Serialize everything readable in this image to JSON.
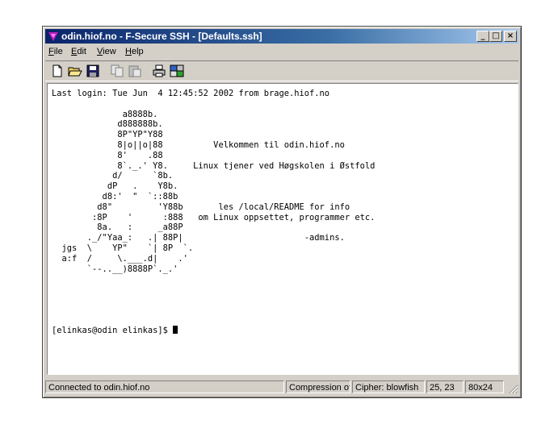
{
  "window": {
    "title": "odin.hiof.no - F-Secure SSH - [Defaults.ssh]",
    "buttons": {
      "minimize": "_",
      "maximize": "□",
      "close": "×"
    }
  },
  "menubar": {
    "items": [
      {
        "label": "File",
        "accel": "F",
        "rest": "ile"
      },
      {
        "label": "Edit",
        "accel": "E",
        "rest": "dit"
      },
      {
        "label": "View",
        "accel": "V",
        "rest": "iew"
      },
      {
        "label": "Help",
        "accel": "H",
        "rest": "elp"
      }
    ]
  },
  "toolbar": {
    "buttons": [
      {
        "name": "new-icon"
      },
      {
        "name": "open-folder-icon"
      },
      {
        "name": "save-icon"
      },
      {
        "name": "copy-icon"
      },
      {
        "name": "paste-icon"
      },
      {
        "name": "print-icon"
      },
      {
        "name": "settings-icon"
      }
    ]
  },
  "terminal": {
    "lines": [
      "Last login: Tue Jun  4 12:45:52 2002 from brage.hiof.no",
      "",
      "              a8888b.",
      "             d888888b.",
      "             8P\"YP\"Y88",
      "             8|o||o|88          Velkommen til odin.hiof.no",
      "             8'    .88",
      "             8`._.' Y8.     Linux tjener ved Høgskolen i Østfold",
      "            d/      `8b.",
      "           dP   .    Y8b.",
      "          d8:'  \"  `::88b",
      "         d8\"         'Y88b       les /local/README for info",
      "        :8P    '      :888   om Linux oppsettet, programmer etc.",
      "         8a.   :     _a88P",
      "       ._/\"Yaa_:   .| 88P|                        -admins.",
      "  jgs  \\    YP\"    `| 8P  `.",
      "  a:f  /     \\.___.d|    .'",
      "       `--..__)8888P`._.'",
      "",
      "",
      "",
      "",
      ""
    ],
    "prompt": "[elinkas@odin elinkas]$ "
  },
  "statusbar": {
    "connection": "Connected to odin.hiof.no",
    "compression": "Compression off",
    "cipher": "Cipher: blowfish",
    "cursor_pos": "25, 23",
    "size": "80x24"
  }
}
